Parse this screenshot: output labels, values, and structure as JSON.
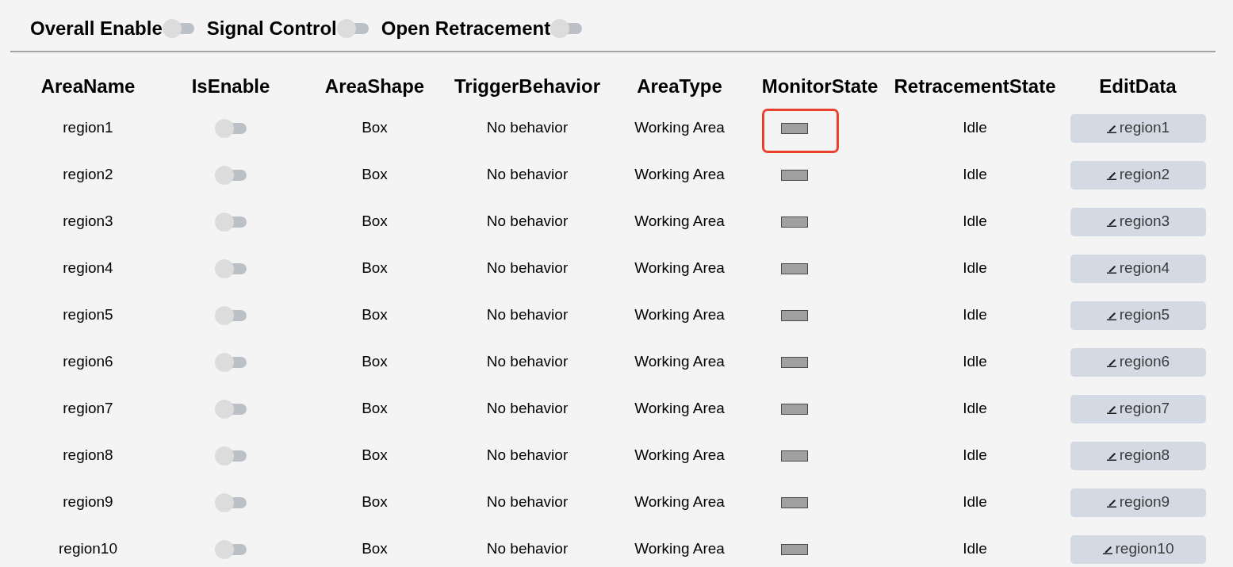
{
  "toolbar": {
    "switches": [
      {
        "label": "Overall Enable",
        "on": false
      },
      {
        "label": "Signal Control",
        "on": false
      },
      {
        "label": "Open Retracement",
        "on": false
      }
    ]
  },
  "table": {
    "columns": [
      "AreaName",
      "IsEnable",
      "AreaShape",
      "TriggerBehavior",
      "AreaType",
      "MonitorState",
      "RetracementState",
      "EditData"
    ],
    "rows": [
      {
        "area_name": "region1",
        "is_enable": false,
        "area_shape": "Box",
        "trigger_behavior": "No behavior",
        "area_type": "Working Area",
        "monitor_highlighted": true,
        "retracement_state": "Idle",
        "edit_label": "region1"
      },
      {
        "area_name": "region2",
        "is_enable": false,
        "area_shape": "Box",
        "trigger_behavior": "No behavior",
        "area_type": "Working Area",
        "monitor_highlighted": false,
        "retracement_state": "Idle",
        "edit_label": "region2"
      },
      {
        "area_name": "region3",
        "is_enable": false,
        "area_shape": "Box",
        "trigger_behavior": "No behavior",
        "area_type": "Working Area",
        "monitor_highlighted": false,
        "retracement_state": "Idle",
        "edit_label": "region3"
      },
      {
        "area_name": "region4",
        "is_enable": false,
        "area_shape": "Box",
        "trigger_behavior": "No behavior",
        "area_type": "Working Area",
        "monitor_highlighted": false,
        "retracement_state": "Idle",
        "edit_label": "region4"
      },
      {
        "area_name": "region5",
        "is_enable": false,
        "area_shape": "Box",
        "trigger_behavior": "No behavior",
        "area_type": "Working Area",
        "monitor_highlighted": false,
        "retracement_state": "Idle",
        "edit_label": "region5"
      },
      {
        "area_name": "region6",
        "is_enable": false,
        "area_shape": "Box",
        "trigger_behavior": "No behavior",
        "area_type": "Working Area",
        "monitor_highlighted": false,
        "retracement_state": "Idle",
        "edit_label": "region6"
      },
      {
        "area_name": "region7",
        "is_enable": false,
        "area_shape": "Box",
        "trigger_behavior": "No behavior",
        "area_type": "Working Area",
        "monitor_highlighted": false,
        "retracement_state": "Idle",
        "edit_label": "region7"
      },
      {
        "area_name": "region8",
        "is_enable": false,
        "area_shape": "Box",
        "trigger_behavior": "No behavior",
        "area_type": "Working Area",
        "monitor_highlighted": false,
        "retracement_state": "Idle",
        "edit_label": "region8"
      },
      {
        "area_name": "region9",
        "is_enable": false,
        "area_shape": "Box",
        "trigger_behavior": "No behavior",
        "area_type": "Working Area",
        "monitor_highlighted": false,
        "retracement_state": "Idle",
        "edit_label": "region9"
      },
      {
        "area_name": "region10",
        "is_enable": false,
        "area_shape": "Box",
        "trigger_behavior": "No behavior",
        "area_type": "Working Area",
        "monitor_highlighted": false,
        "retracement_state": "Idle",
        "edit_label": "region10"
      }
    ]
  }
}
